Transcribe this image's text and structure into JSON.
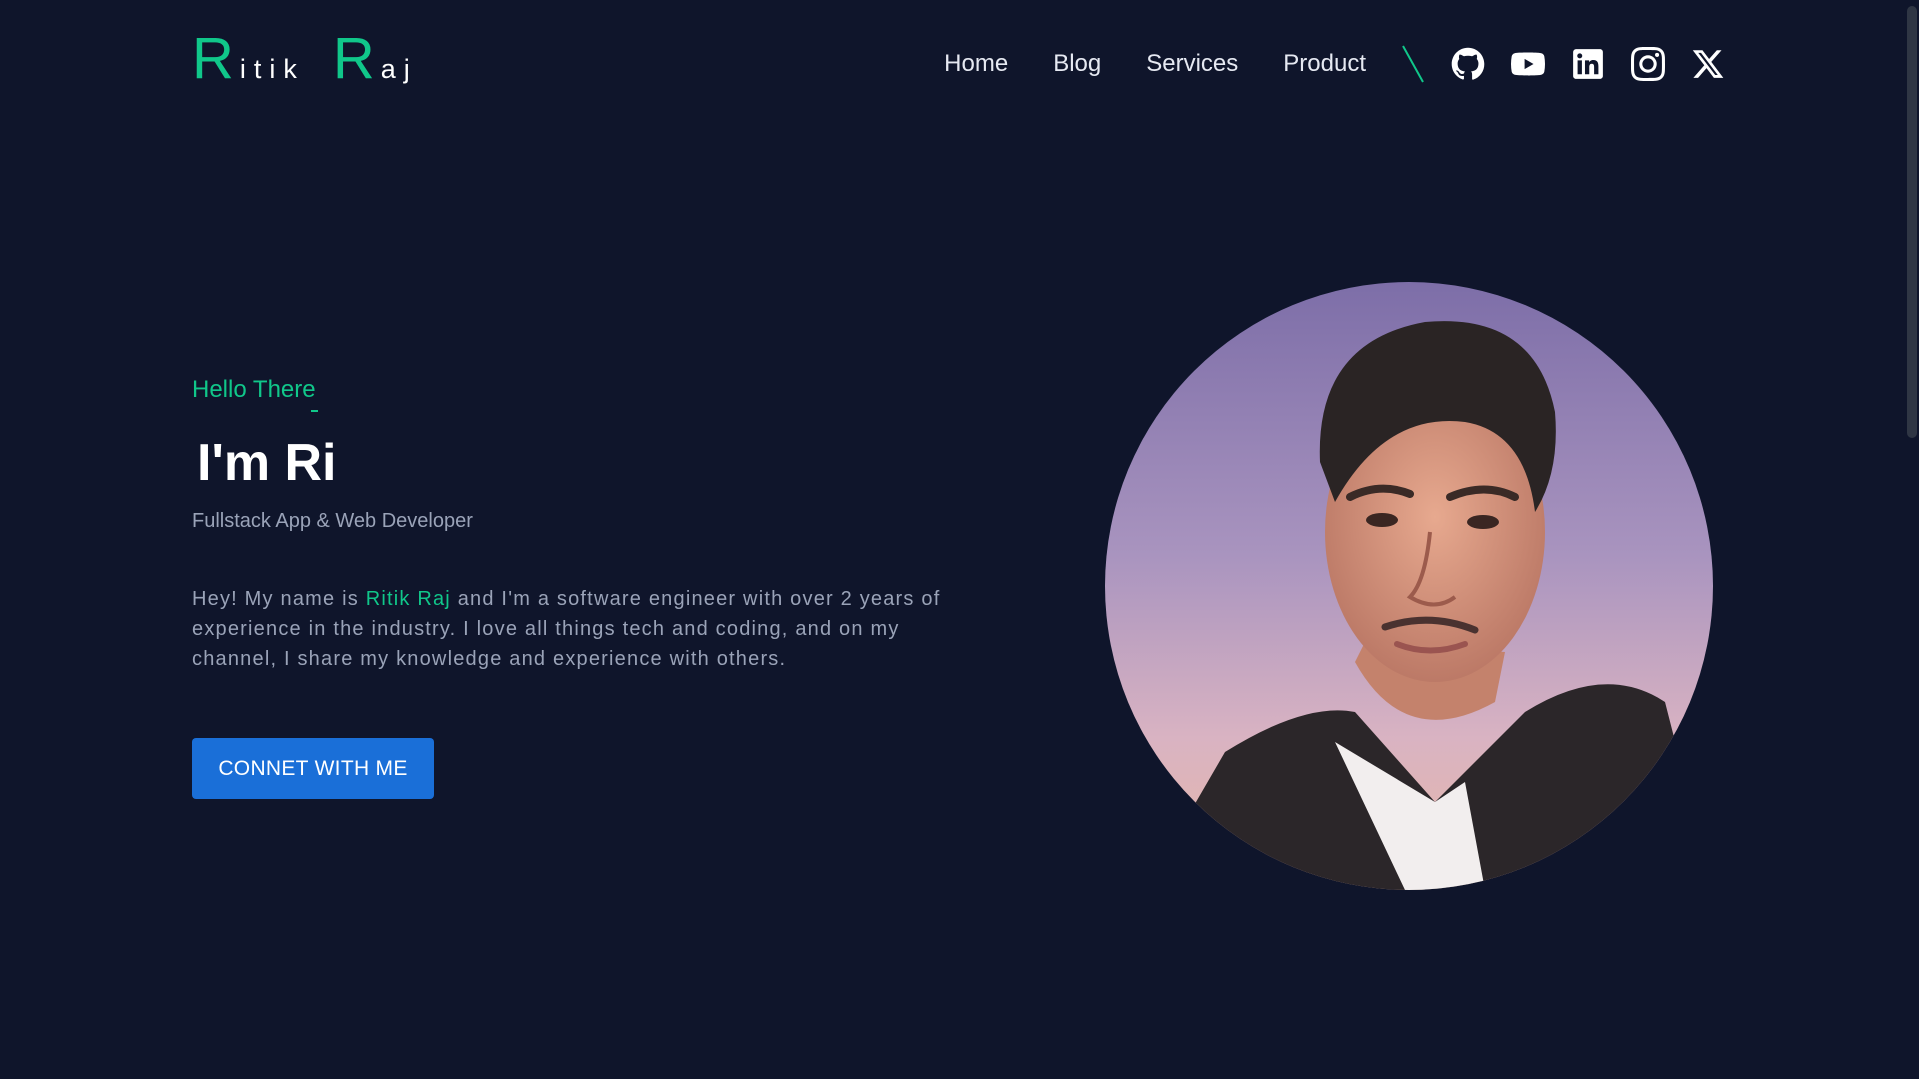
{
  "header": {
    "logo": {
      "first_initial": "R",
      "first_rest": "itik",
      "last_initial": "R",
      "last_rest": "aj"
    },
    "nav": [
      {
        "label": "Home"
      },
      {
        "label": "Blog"
      },
      {
        "label": "Services"
      },
      {
        "label": "Product"
      }
    ],
    "social_icons": [
      "github-icon",
      "youtube-icon",
      "linkedin-icon",
      "instagram-icon",
      "x-icon"
    ]
  },
  "hero": {
    "greeting": "Hello There",
    "headline": "I'm Ri",
    "role": "Fullstack App & Web Developer",
    "intro_before": "Hey! My name is ",
    "intro_name": "Ritik Raj",
    "intro_after": " and I'm a software engineer with over 2 years of experience in the industry. I love all things tech and coding, and on my channel, I share my knowledge and experience with others.",
    "cta_label": "CONNET WITH ME"
  },
  "colors": {
    "background": "#0f152b",
    "accent": "#10c78a",
    "button": "#1a6fd8",
    "muted_text": "#9aa3b8"
  }
}
